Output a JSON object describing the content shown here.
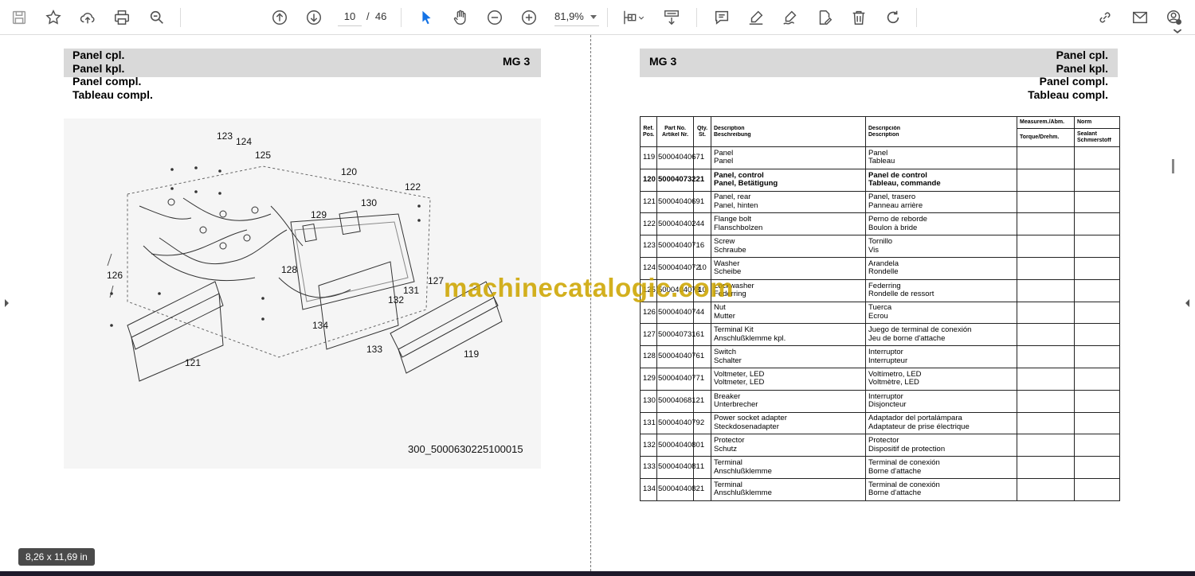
{
  "toolbar": {
    "current_page": "10",
    "page_separator": "/",
    "total_pages": "46",
    "zoom": "81,9%"
  },
  "status": {
    "page_size": "8,26 x 11,69 in"
  },
  "left_page": {
    "title_lines": [
      "Panel cpl.",
      "Panel kpl.",
      "Panel compl.",
      "Tableau compl."
    ],
    "group": "MG 3",
    "callouts": [
      "123",
      "124",
      "125",
      "120",
      "122",
      "129",
      "130",
      "126",
      "128",
      "127",
      "131",
      "132",
      "134",
      "133",
      "121",
      "119"
    ],
    "figure_code": "300_5000630225100015"
  },
  "right_page": {
    "group": "MG 3",
    "title_lines": [
      "Panel cpl.",
      "Panel kpl.",
      "Panel compl.",
      "Tableau compl."
    ],
    "table": {
      "headers": {
        "ref": [
          "Ref.",
          "Pos."
        ],
        "part": [
          "Part No.",
          "Artikel Nr."
        ],
        "qty": [
          "Qty.",
          "St."
        ],
        "desc1": [
          "Description",
          "Beschreibung"
        ],
        "desc2": [
          "Descripción",
          "Description"
        ],
        "measure_top": "Measurem./Abm.",
        "measure_bottom": "Torque/Drehm.",
        "norm_top": "Norm",
        "norm_bottom": [
          "Sealant",
          "Schmierstoff"
        ]
      },
      "rows": [
        {
          "ref": "119",
          "part": "5000404067",
          "qty": "1",
          "d1": "Panel",
          "d2": "Panel",
          "e1": "Panel",
          "e2": "Tableau",
          "bold": false
        },
        {
          "ref": "120",
          "part": "5000407322",
          "qty": "1",
          "d1": "Panel, control",
          "d2": "Panel, Betätigung",
          "e1": "Panel de control",
          "e2": "Tableau, commande",
          "bold": true
        },
        {
          "ref": "121",
          "part": "5000404069",
          "qty": "1",
          "d1": "Panel, rear",
          "d2": "Panel, hinten",
          "e1": "Panel, trasero",
          "e2": "Panneau arrière",
          "bold": false
        },
        {
          "ref": "122",
          "part": "5000404024",
          "qty": "4",
          "d1": "Flange bolt",
          "d2": "Flanschbolzen",
          "e1": "Perno de reborde",
          "e2": "Boulon à bride",
          "bold": false
        },
        {
          "ref": "123",
          "part": "5000404071",
          "qty": "6",
          "d1": "Screw",
          "d2": "Schraube",
          "e1": "Tornillo",
          "e2": "Vis",
          "bold": false
        },
        {
          "ref": "124",
          "part": "5000404072",
          "qty": "10",
          "d1": "Washer",
          "d2": "Scheibe",
          "e1": "Arandela",
          "e2": "Rondelle",
          "bold": false
        },
        {
          "ref": "125",
          "part": "5000404073",
          "qty": "10",
          "d1": "Lockwasher",
          "d2": "Federring",
          "e1": "Federring",
          "e2": "Rondelle de ressort",
          "bold": false
        },
        {
          "ref": "126",
          "part": "5000404074",
          "qty": "4",
          "d1": "Nut",
          "d2": "Mutter",
          "e1": "Tuerca",
          "e2": "Écrou",
          "bold": false
        },
        {
          "ref": "127",
          "part": "5000407316",
          "qty": "1",
          "d1": "Terminal Kit",
          "d2": "Anschlußklemme kpl.",
          "e1": "Juego de terminal de conexión",
          "e2": "Jeu de borne d'attache",
          "bold": false
        },
        {
          "ref": "128",
          "part": "5000404076",
          "qty": "1",
          "d1": "Switch",
          "d2": "Schalter",
          "e1": "Interruptor",
          "e2": "Interrupteur",
          "bold": false
        },
        {
          "ref": "129",
          "part": "5000404077",
          "qty": "1",
          "d1": "Voltmeter, LED",
          "d2": "Voltmeter, LED",
          "e1": "Voltímetro, LED",
          "e2": "Voltmètre, LED",
          "bold": false
        },
        {
          "ref": "130",
          "part": "5000406812",
          "qty": "1",
          "d1": "Breaker",
          "d2": "Unterbrecher",
          "e1": "Interruptor",
          "e2": "Disjoncteur",
          "bold": false
        },
        {
          "ref": "131",
          "part": "5000404079",
          "qty": "2",
          "d1": "Power socket adapter",
          "d2": "Steckdosenadapter",
          "e1": "Adaptador del portalámpara",
          "e2": "Adaptateur de prise électrique",
          "bold": false
        },
        {
          "ref": "132",
          "part": "5000404080",
          "qty": "1",
          "d1": "Protector",
          "d2": "Schutz",
          "e1": "Protector",
          "e2": "Dispositif de protection",
          "bold": false
        },
        {
          "ref": "133",
          "part": "5000404081",
          "qty": "1",
          "d1": "Terminal",
          "d2": "Anschlußklemme",
          "e1": "Terminal de conexión",
          "e2": "Borne d'attache",
          "bold": false
        },
        {
          "ref": "134",
          "part": "5000404082",
          "qty": "1",
          "d1": "Terminal",
          "d2": "Anschlußklemme",
          "e1": "Terminal de conexión",
          "e2": "Borne d'attache",
          "bold": false
        }
      ]
    }
  },
  "watermark": "machinecatalogic.com"
}
